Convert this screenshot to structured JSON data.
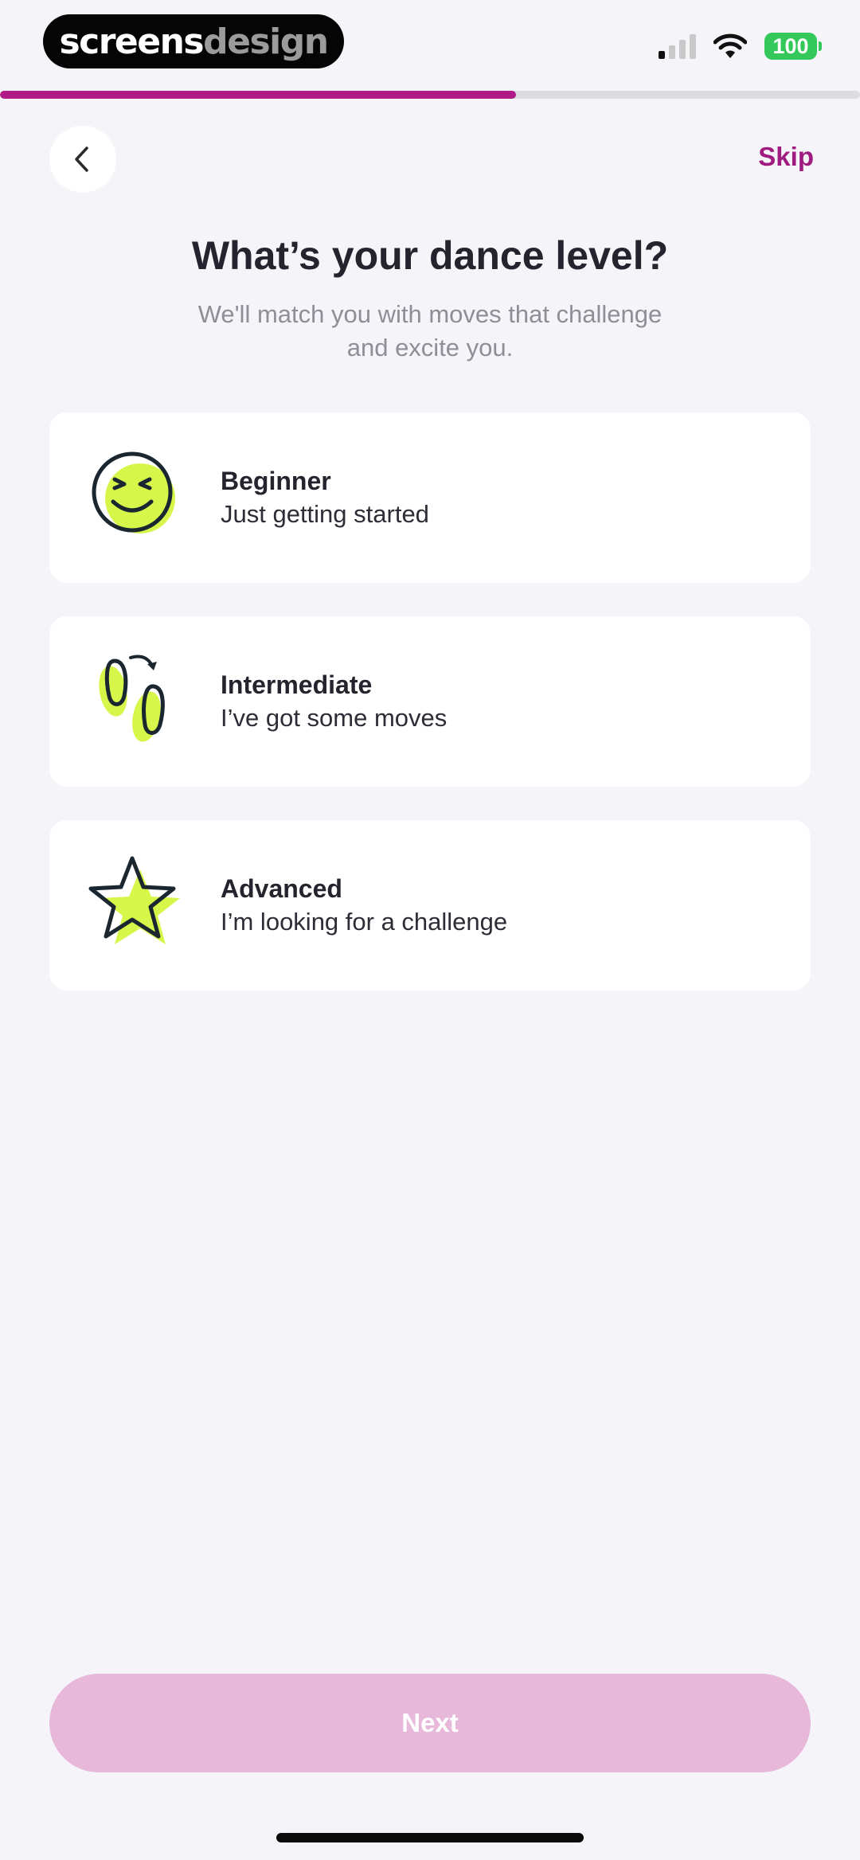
{
  "status_bar": {
    "brand_part1": "screens",
    "brand_part2": "design",
    "battery": "100",
    "icons": [
      "signal-icon",
      "wifi-icon",
      "battery-icon"
    ]
  },
  "progress": {
    "fraction": 0.6
  },
  "header": {
    "back_icon": "chevron-left-icon",
    "skip_label": "Skip"
  },
  "title": "What’s your dance level?",
  "subtitle": "We'll match you with moves that challenge and excite you.",
  "options": [
    {
      "label": "Beginner",
      "desc": "Just getting started",
      "icon": "smiley-icon"
    },
    {
      "label": "Intermediate",
      "desc": "I’ve got some moves",
      "icon": "footprints-icon"
    },
    {
      "label": "Advanced",
      "desc": "I’m looking for a challenge",
      "icon": "star-icon"
    }
  ],
  "next_label": "Next",
  "colors": {
    "accent": "#a01b80",
    "progress": "#b01a86",
    "highlight": "#d7f64a",
    "next_disabled": "#e7b8da",
    "background": "#f5f4f9"
  }
}
